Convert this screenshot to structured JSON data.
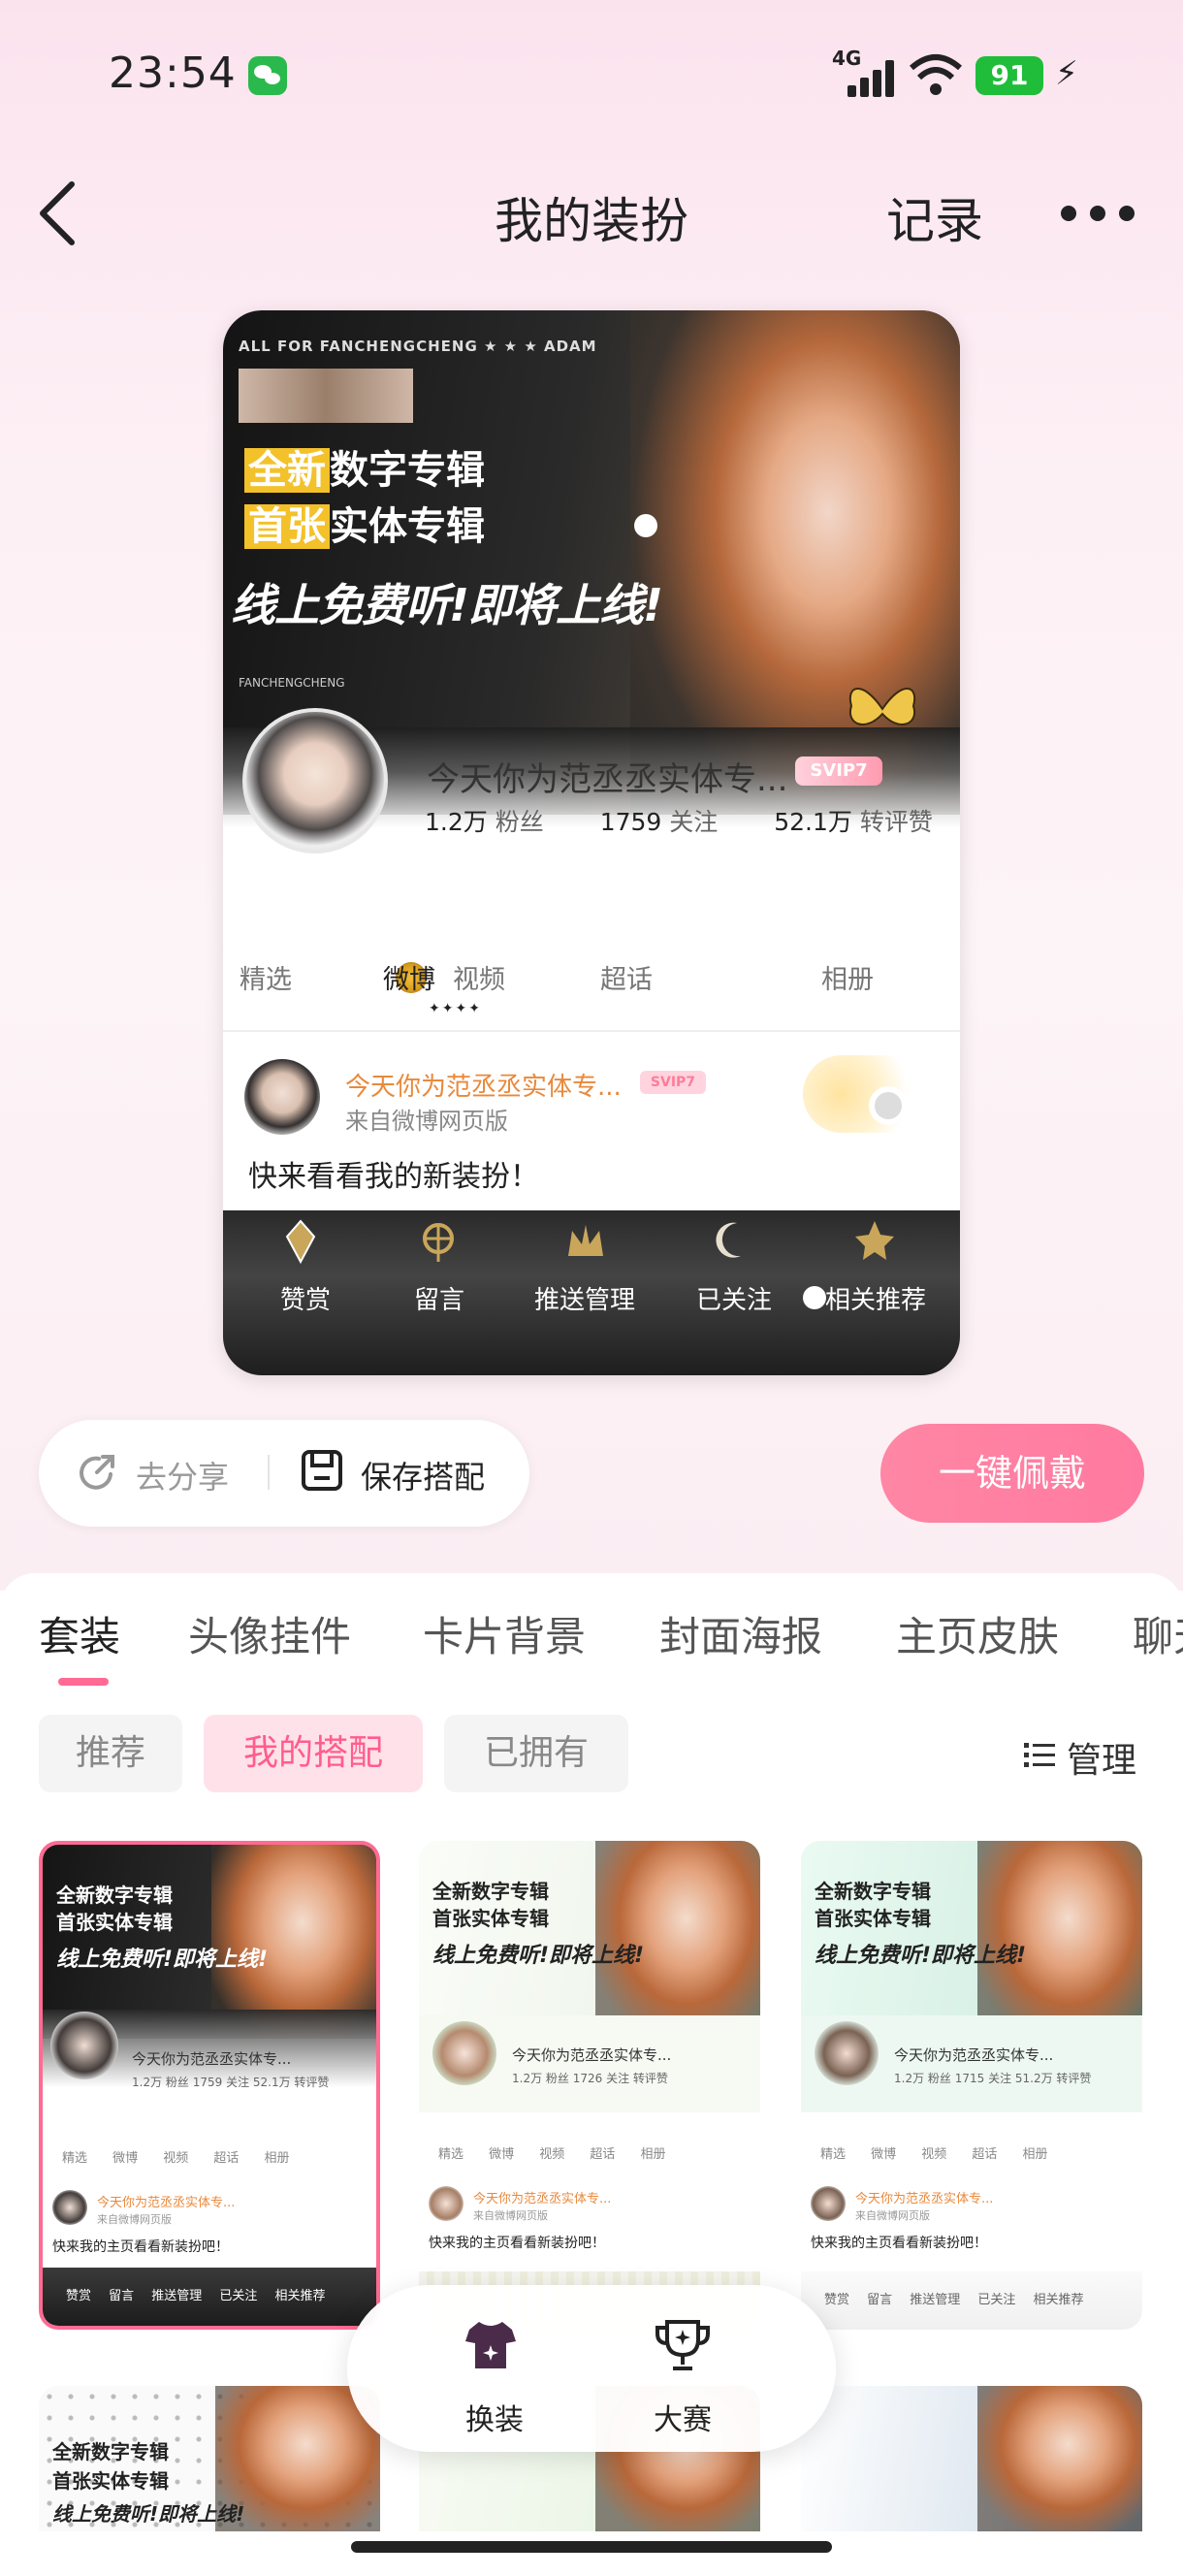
{
  "status_bar": {
    "time": "23:54",
    "network": "4G",
    "battery": "91"
  },
  "header": {
    "title": "我的装扮",
    "record_label": "记录"
  },
  "preview": {
    "banner": {
      "top_text": "ALL FOR FANCHENGCHENG ★ ★ ★ ADAM",
      "headline1_mark": "全新",
      "headline1_rest": "数字专辑",
      "headline2_mark": "首张",
      "headline2_rest": "实体专辑",
      "headline3": "线上免费听!即将上线!",
      "brand": "FANCHENGCHENG"
    },
    "profile": {
      "name": "今天你为范丞丞实体专...",
      "badge": "SVIP7",
      "fans_num": "1.2万",
      "fans_label": "粉丝",
      "follow_num": "1759",
      "follow_label": "关注",
      "likes_num": "52.1万",
      "likes_label": "转评赞"
    },
    "tabs": [
      "精选",
      "微博",
      "视频",
      "超话",
      "相册"
    ],
    "post": {
      "name": "今天你为范丞丞实体专...",
      "badge": "SVIP7",
      "source": "来自微博网页版",
      "text": "快来看看我的新装扮！"
    },
    "actions": [
      "赞赏",
      "留言",
      "推送管理",
      "已关注",
      "相关推荐"
    ]
  },
  "share": {
    "share_label": "去分享",
    "save_label": "保存搭配",
    "wear_label": "一键佩戴"
  },
  "categories": [
    "套装",
    "头像挂件",
    "卡片背景",
    "封面海报",
    "主页皮肤",
    "聊天"
  ],
  "filters": [
    "推荐",
    "我的搭配",
    "已拥有"
  ],
  "manage_label": "管理",
  "outfits": [
    {
      "headline1": "全新数字专辑",
      "headline2": "首张实体专辑",
      "headline3": "线上免费听!即将上线!",
      "name": "今天你为范丞丞实体专...",
      "stats": "1.2万 粉丝   1759 关注   52.1万 转评赞",
      "tabs": "精选 微博 视频 超话 相册",
      "post_name": "今天你为范丞丞实体专...",
      "post_src": "来自微博网页版",
      "post_text": "快来我的主页看看新装扮吧！",
      "actions": "赞赏 留言 推送管理 已关注 相关推荐"
    },
    {
      "headline1": "全新数字专辑",
      "headline2": "首张实体专辑",
      "headline3": "线上免费听!即将上线!",
      "name": "今天你为范丞丞实体专...",
      "stats": "1.2万 粉丝   1726 关注   转评赞",
      "tabs": "精选 微博 视频 超话 相册",
      "post_name": "今天你为范丞丞实体专...",
      "post_src": "来自微博网页版",
      "post_text": "快来我的主页看看新装扮吧！",
      "actions": ""
    },
    {
      "headline1": "全新数字专辑",
      "headline2": "首张实体专辑",
      "headline3": "线上免费听!即将上线!",
      "name": "今天你为范丞丞实体专...",
      "stats": "1.2万 粉丝   1715 关注   51.2万 转评赞",
      "tabs": "精选 微博 视频 超话 相册",
      "post_name": "今天你为范丞丞实体专...",
      "post_src": "来自微博网页版",
      "post_text": "快来我的主页看看新装扮吧！",
      "actions": "赞赏 留言 推送管理 已关注 相关推荐"
    }
  ],
  "outfits_row2": {
    "headline1": "全新数字专辑",
    "headline2": "首张实体专辑",
    "headline3": "线上免费听!即将上线!"
  },
  "float_nav": [
    "换装",
    "大赛"
  ],
  "colors": {
    "accent": "#ff6b94",
    "wear_button": "#ff86a4",
    "badge": "#ff9bb1"
  }
}
